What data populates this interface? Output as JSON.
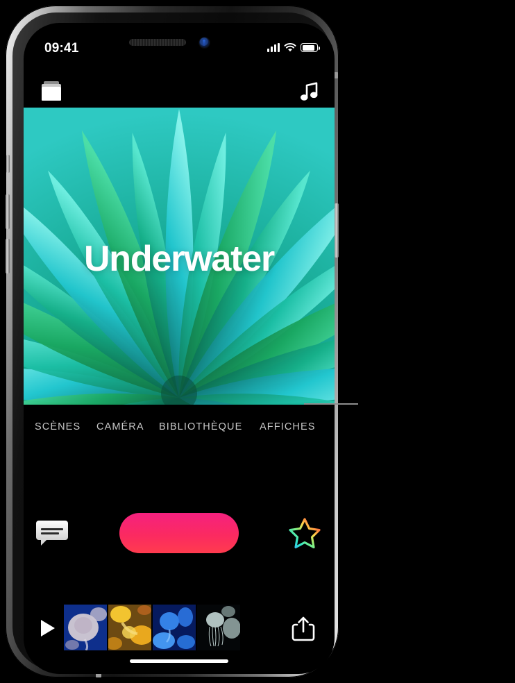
{
  "device": {
    "frame_color": "#bdbdbd",
    "screen_bg": "#000000"
  },
  "status_bar": {
    "time": "09:41",
    "cellular_icon": "signal-bars-icon",
    "wifi_icon": "wifi-icon",
    "battery_icon": "battery-icon"
  },
  "app_bar": {
    "projects_icon": "projects-folder-icon",
    "music_icon": "music-note-icon"
  },
  "poster": {
    "title": "Underwater",
    "art_name": "underwater-radial-petals-artwork",
    "colors": {
      "teal_light": "#5fe2d8",
      "teal": "#19c3b6",
      "green": "#1aa85f",
      "green_dark": "#0e7a46",
      "cyan": "#3fd4dd"
    }
  },
  "tabs": [
    {
      "label": "SCÈNES",
      "selected": false
    },
    {
      "label": "CAMÉRA",
      "selected": false
    },
    {
      "label": "BIBLIOTHÈQUE",
      "selected": false
    },
    {
      "label": "AFFICHES",
      "selected": true
    }
  ],
  "controls": {
    "text_bubble_icon": "text-bubble-icon",
    "record_button": {
      "name": "record-button",
      "gradient_from": "#f5217f",
      "gradient_to": "#ff3b4e"
    },
    "effects_star_icon": "rainbow-star-icon"
  },
  "bottom_strip": {
    "play_icon": "play-icon",
    "share_icon": "share-icon",
    "thumbnails": [
      {
        "name": "clip-thumbnail-1",
        "description": "jellyfish-pale-blue"
      },
      {
        "name": "clip-thumbnail-2",
        "description": "jellyfish-yellow-orange"
      },
      {
        "name": "clip-thumbnail-3",
        "description": "jellyfish-bright-blue"
      },
      {
        "name": "clip-thumbnail-4",
        "description": "jellyfish-dark-white"
      }
    ]
  },
  "home_indicator": "home-indicator",
  "callout": {
    "name": "callout-leader-line",
    "points_to": "AFFICHES"
  }
}
